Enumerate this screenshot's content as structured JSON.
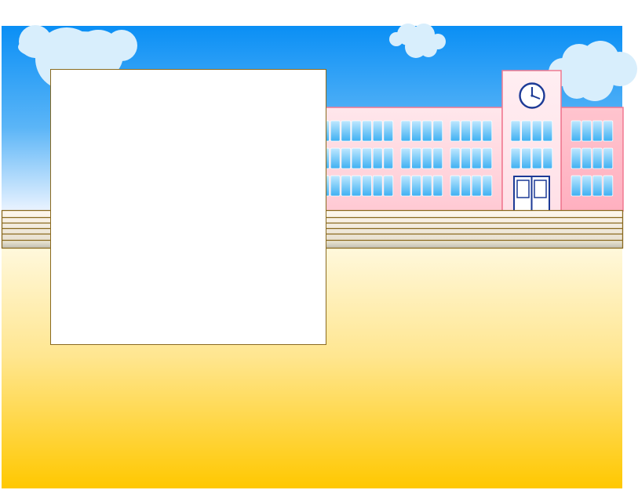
{
  "scene": {
    "sky_top": "#0a8ff5",
    "sky_bottom": "#e6f2ff",
    "ground_top": "#fff5d0",
    "ground_bottom": "#ffc800",
    "building_color": "#ffd2da",
    "building_outline": "#f07890",
    "window_color": "#6cc8ff",
    "clock_color": "#1c3a96",
    "fence_color": "#8a6a1f",
    "cloud_color": "#d8eefc"
  },
  "panel": {
    "background": "#ffffff",
    "border": "#8a6a1f"
  }
}
